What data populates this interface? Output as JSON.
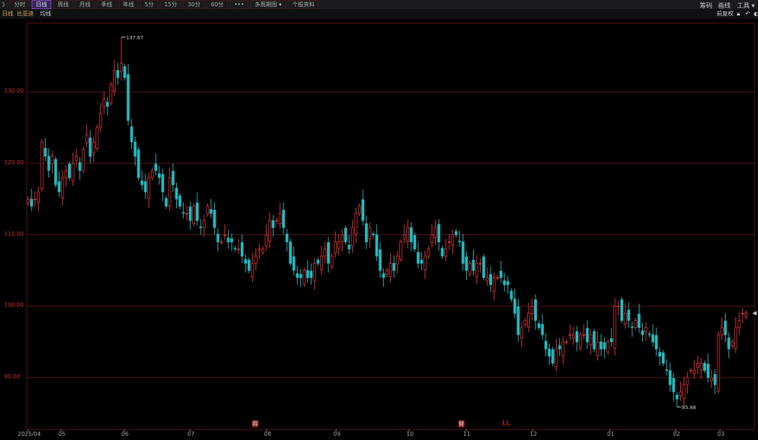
{
  "toolbar": {
    "expand": "》",
    "tabs": [
      "分时",
      "日线",
      "周线",
      "月线",
      "季线",
      "年线",
      "5分",
      "15分",
      "30分",
      "60分",
      "•••",
      "多周期图 ▾",
      "个股资料"
    ],
    "active": "日线",
    "right": [
      "筹码",
      "画线",
      "工具 ▾"
    ]
  },
  "subbar": {
    "period": "日线",
    "stock": "比亚迪",
    "indicator": "均线",
    "adjust": "前复权"
  },
  "chart_data": {
    "type": "candlestick",
    "ylim": [
      84,
      140
    ],
    "yticks": [
      "130.00",
      "120.00",
      "110.00",
      "100.00",
      "90.00"
    ],
    "ytick_values": [
      130,
      120,
      110,
      100,
      90
    ],
    "xticks": [
      "2025/04",
      "05",
      "06",
      "07",
      "08",
      "09",
      "10",
      "11",
      "12",
      "01",
      "02",
      "03"
    ],
    "max_label": "137.67",
    "min_label": "85.88",
    "max": 137.67,
    "min": 85.88,
    "markers": [
      "四",
      "财",
      "LL"
    ],
    "colors": {
      "up": "#e8363a",
      "down": "#1fbcc0",
      "grid": "#5a1616"
    },
    "close": [
      115,
      114,
      115,
      116,
      123,
      121,
      119,
      121,
      117,
      116,
      118,
      119,
      118,
      120,
      121,
      119,
      122,
      124,
      121,
      123,
      125,
      127,
      129,
      128,
      131,
      133,
      132,
      134,
      132,
      126,
      123,
      121,
      118,
      117,
      116,
      118,
      119,
      119,
      118,
      116,
      114,
      118,
      117,
      115,
      114,
      113,
      113,
      112,
      114,
      112,
      111,
      112,
      114,
      113,
      111,
      109,
      109,
      110,
      109,
      109,
      108,
      108,
      107,
      106,
      105,
      106,
      107,
      108,
      108,
      110,
      112,
      111,
      112,
      113,
      111,
      109,
      106,
      105,
      104,
      104,
      105,
      104,
      104,
      106,
      106,
      107,
      108,
      106,
      107,
      109,
      109,
      110,
      109,
      108,
      111,
      113,
      114,
      112,
      109,
      111,
      110,
      107,
      105,
      104,
      105,
      106,
      105,
      107,
      109,
      110,
      111,
      109,
      108,
      106,
      106,
      107,
      108,
      110,
      111,
      109,
      107,
      108,
      109,
      110,
      110,
      109,
      106,
      105,
      106,
      105,
      106,
      106,
      104,
      104,
      103,
      104,
      104,
      104,
      103,
      103,
      101,
      99,
      96,
      97,
      98,
      99,
      100,
      98,
      97,
      96,
      94,
      93,
      92,
      94,
      94,
      95,
      95,
      96,
      96,
      95,
      96,
      96,
      95,
      96,
      94,
      95,
      94,
      94,
      95,
      95,
      100,
      100,
      98,
      99,
      98,
      97,
      98,
      97,
      96,
      97,
      96,
      95,
      94,
      93,
      92,
      91,
      89,
      88,
      87,
      88,
      89,
      90,
      91,
      91,
      92,
      92,
      91,
      90,
      90,
      89,
      96,
      97,
      96,
      94,
      95,
      97,
      98,
      99,
      99
    ]
  }
}
